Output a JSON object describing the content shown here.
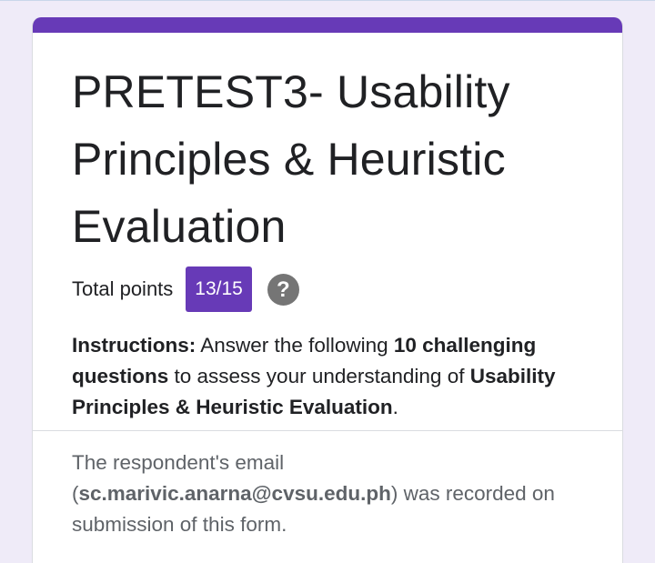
{
  "form": {
    "title": "PRETEST3- Usability Principles & Heuristic Evaluation",
    "accent_color": "#673ab7",
    "score": {
      "label": "Total points",
      "value": "13/15",
      "help_icon": "help-icon"
    },
    "instructions": {
      "lead": "Instructions:",
      "part1": " Answer the following ",
      "bold1": "10 challenging questions",
      "part2": " to assess your understanding of ",
      "bold2": "Usability Principles & Heuristic Evaluation",
      "part3": "."
    },
    "email_notice": {
      "prefix": "The respondent's email (",
      "email": "sc.marivic.anarna@cvsu.edu.ph",
      "suffix": ") was recorded on submission of this form."
    }
  }
}
